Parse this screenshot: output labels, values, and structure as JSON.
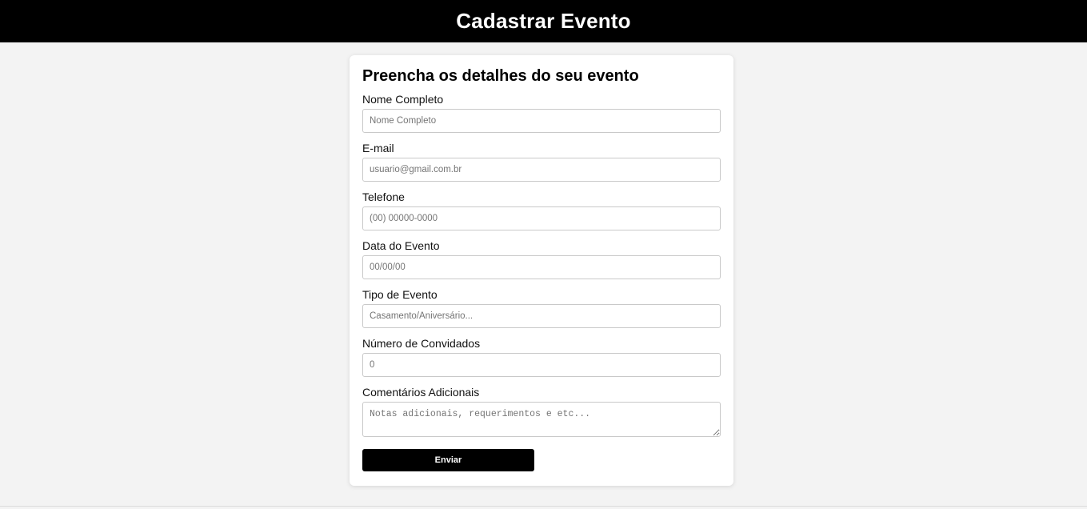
{
  "header": {
    "title": "Cadastrar Evento"
  },
  "form": {
    "heading": "Preencha os detalhes do seu evento",
    "fields": [
      {
        "label": "Nome Completo",
        "placeholder": "Nome Completo",
        "value": ""
      },
      {
        "label": "E-mail",
        "placeholder": "usuario@gmail.com.br",
        "value": ""
      },
      {
        "label": "Telefone",
        "placeholder": "(00) 00000-0000",
        "value": ""
      },
      {
        "label": "Data do Evento",
        "placeholder": "00/00/00",
        "value": ""
      },
      {
        "label": "Tipo de Evento",
        "placeholder": "Casamento/Aniversário...",
        "value": ""
      },
      {
        "label": "Número de Convidados",
        "placeholder": "0",
        "value": ""
      }
    ],
    "comments": {
      "label": "Comentários Adicionais",
      "placeholder": "Notas adicionais, requerimentos e etc...",
      "value": ""
    },
    "submit_label": "Enviar"
  },
  "colors": {
    "header_bg": "#000000",
    "page_bg": "#f3f3f3",
    "button_bg": "#000000"
  }
}
